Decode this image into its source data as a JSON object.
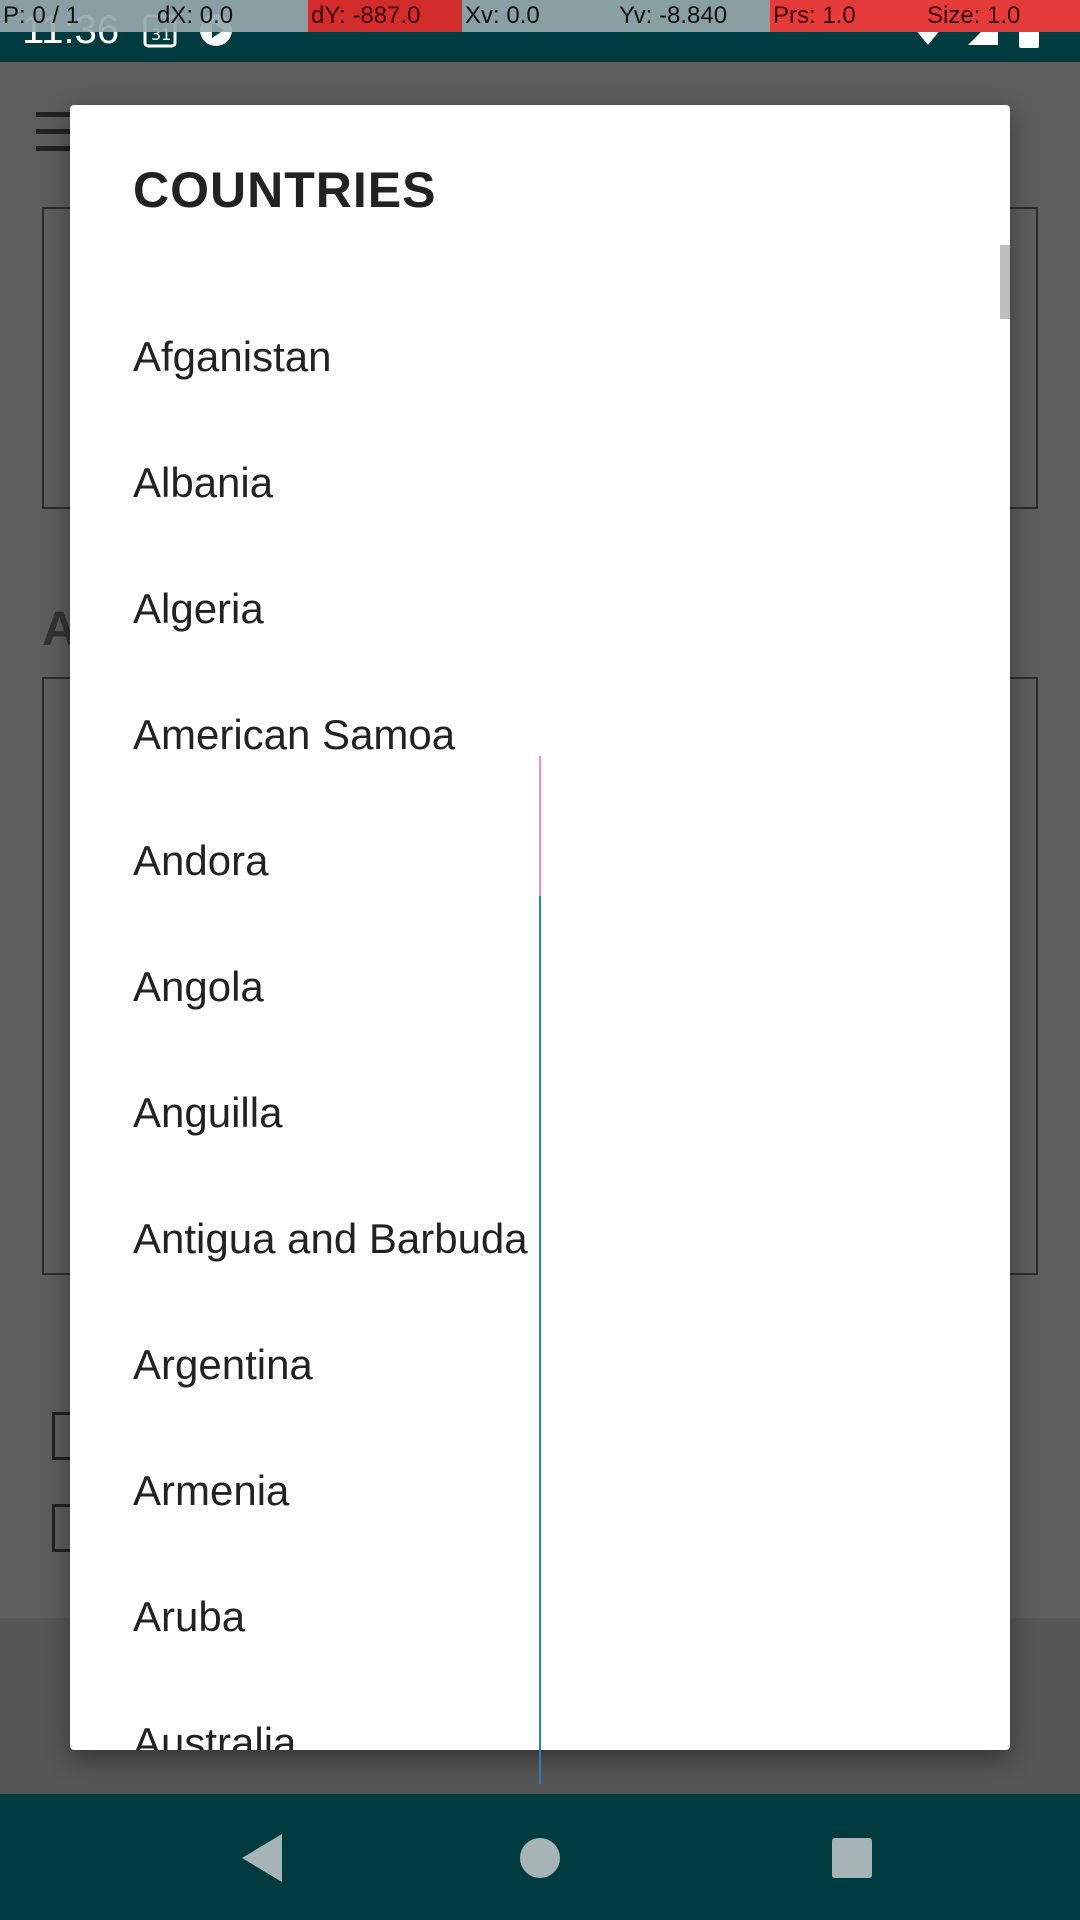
{
  "status_bar": {
    "time": "11:36"
  },
  "debug_overlay": {
    "pointer": "P: 0 / 1",
    "dx": "dX: 0.0",
    "dy": "dY: -887.0",
    "xv": "Xv: 0.0",
    "yv": "Yv: -8.840",
    "prs": "Prs: 1.0",
    "size": "Size: 1.0"
  },
  "dialog": {
    "title": "COUNTRIES",
    "countries": [
      "Afganistan",
      "Albania",
      "Algeria",
      "American Samoa",
      "Andora",
      "Angola",
      "Anguilla",
      "Antigua and Barbuda",
      "Argentina",
      "Armenia",
      "Aruba",
      "Australia"
    ]
  },
  "background": {
    "partial_letter": "A"
  },
  "colors": {
    "system_bar": "#003b40",
    "scrim": "#5b5b5b",
    "dialog_bg": "#ffffff",
    "text": "#222222"
  },
  "icons": {
    "nav_back": "back-triangle-icon",
    "nav_home": "home-circle-icon",
    "nav_recents": "recents-square-icon"
  }
}
